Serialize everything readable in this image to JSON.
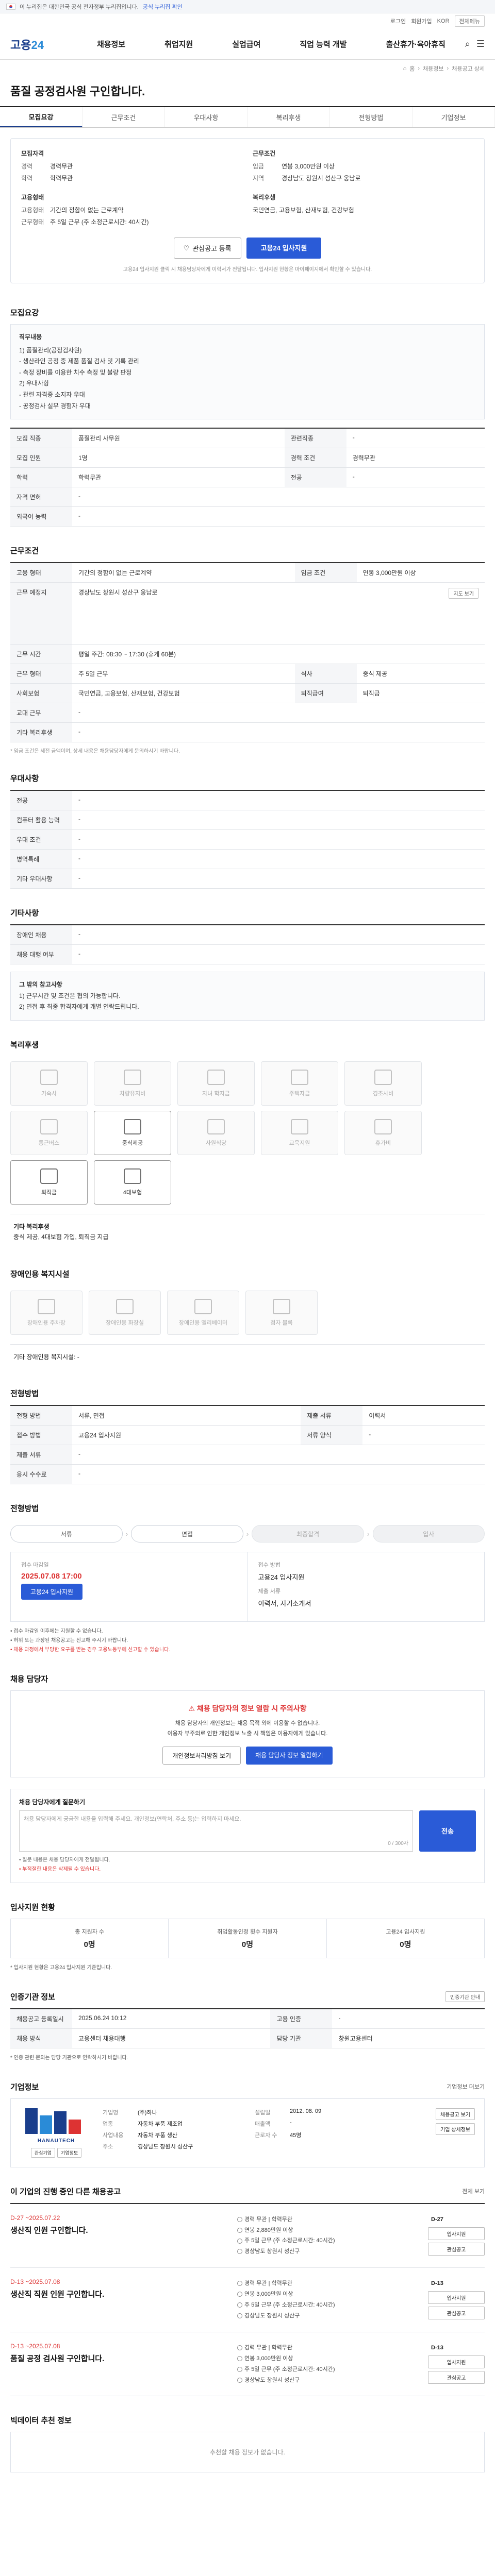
{
  "topbar": {
    "notice": "이 누리집은 대한민국 공식 전자정부 누리집입니다.",
    "link": "공식 누리집 확인"
  },
  "util": {
    "login": "로그인",
    "join": "회원가입",
    "lang": "KOR",
    "btn": "전체메뉴"
  },
  "header": {
    "logo_main": "고용",
    "logo_sub": "24",
    "gnb": [
      "채용정보",
      "취업지원",
      "실업급여",
      "직업 능력 개발",
      "출산휴가·육아휴직"
    ]
  },
  "breadcrumb": [
    "홈",
    "채용정보",
    "채용공고 상세"
  ],
  "title": "품질 공정검사원 구인합니다.",
  "tabs": [
    "모집요강",
    "근무조건",
    "우대사항",
    "복리후생",
    "전형방법",
    "기업정보"
  ],
  "summary": {
    "recruit_title": "모집자격",
    "recruit": [
      {
        "k": "경력",
        "v": "경력무관"
      },
      {
        "k": "학력",
        "v": "학력무관"
      }
    ],
    "work_title": "근무조건",
    "work": [
      {
        "k": "임금",
        "v": "연봉 3,000만원 이상"
      },
      {
        "k": "지역",
        "v": "경상남도 창원시 성산구 웅남로"
      }
    ],
    "type_title": "고용형태",
    "type": [
      {
        "k": "고용형태",
        "v": "기간의 정함이 없는 근로계약"
      },
      {
        "k": "근무형태",
        "v": "주 5일 근무 (주 소정근로시간: 40시간)"
      }
    ],
    "welfare_title": "복리후생",
    "welfare": [
      {
        "k": "",
        "v": "국민연금, 고용보험, 산재보험, 건강보험"
      }
    ],
    "interest_btn": "관심공고 등록",
    "apply_btn": "고용24 입사지원",
    "note": "고용24 입사지원 클릭 시 채용담당자에게 이력서가 전달됩니다. 입사지원 현황은 마이페이지에서 확인할 수 있습니다."
  },
  "recruit_section": {
    "title": "모집요강",
    "duties_label": "직무내용",
    "duties": [
      "1) 품질관리(공정검사원)",
      "- 생산라인 공정 중 제품 품질 검사 및 기록 관리",
      "- 측정 장비를 이용한 치수 측정 및 불량 판정",
      "2) 우대사항",
      "- 관련 자격증 소지자 우대",
      "- 공정검사 실무 경험자 우대"
    ],
    "table": [
      {
        "k": "모집 직종",
        "v": "품질관리 사무원",
        "k2": "관련직종",
        "v2": "-"
      },
      {
        "k": "모집 인원",
        "v": "1명",
        "k2": "경력 조건",
        "v2": "경력무관"
      },
      {
        "k": "학력",
        "v": "학력무관",
        "k2": "전공",
        "v2": "-"
      },
      {
        "k": "자격 면허",
        "v": "-",
        "k2": "",
        "v2": ""
      },
      {
        "k": "외국어 능력",
        "v": "-",
        "k2": "",
        "v2": ""
      }
    ]
  },
  "work_section": {
    "title": "근무조건",
    "table": [
      {
        "k": "고용 형태",
        "v": "기간의 정함이 없는 근로계약",
        "k2": "임금 조건",
        "v2": "연봉 3,000만원 이상"
      },
      {
        "k": "근무 예정지",
        "v": "경상남도 창원시 성산구 웅남로",
        "k2": "",
        "v2": ""
      },
      {
        "k": "근무 시간",
        "v": "평일 주간: 08:30 ~ 17:30 (휴게 60분)",
        "k2": "",
        "v2": ""
      },
      {
        "k": "근무 형태",
        "v": "주 5일 근무",
        "k2": "식사",
        "v2": "중식 제공"
      },
      {
        "k": "사회보험",
        "v": "국민연금, 고용보험, 산재보험, 건강보험",
        "k2": "퇴직급여",
        "v2": "퇴직금"
      },
      {
        "k": "교대 근무",
        "v": "-",
        "k2": "",
        "v2": ""
      },
      {
        "k": "기타 복리후생",
        "v": "-",
        "k2": "",
        "v2": ""
      }
    ],
    "map_btn": "지도 보기",
    "foot": "* 임금 조건은 세전 금액이며, 상세 내용은 채용담당자에게 문의하시기 바랍니다."
  },
  "pref_section": {
    "title": "우대사항",
    "table": [
      {
        "k": "전공",
        "v": "-"
      },
      {
        "k": "컴퓨터 활용 능력",
        "v": "-"
      },
      {
        "k": "우대 조건",
        "v": "-"
      },
      {
        "k": "병역특례",
        "v": "-"
      },
      {
        "k": "기타 우대사항",
        "v": "-"
      }
    ]
  },
  "etc_section": {
    "title": "기타사항",
    "table": [
      {
        "k": "장애인 채용",
        "v": "-"
      },
      {
        "k": "채용 대행 여부",
        "v": "-"
      }
    ],
    "notes_title": "그 밖의 참고사항",
    "notes": [
      "1) 근무시간 및 조건은 협의 가능합니다.",
      "2) 면접 후 최종 합격자에게 개별 연락드립니다."
    ]
  },
  "welfare_section": {
    "title": "복리후생",
    "items": [
      {
        "label": "기숙사",
        "on": false
      },
      {
        "label": "차량유지비",
        "on": false
      },
      {
        "label": "자녀 학자금",
        "on": false
      },
      {
        "label": "주택자금",
        "on": false
      },
      {
        "label": "경조사비",
        "on": false
      },
      {
        "label": "통근버스",
        "on": false
      },
      {
        "label": "중식제공",
        "on": true
      },
      {
        "label": "사원식당",
        "on": false
      },
      {
        "label": "교육지원",
        "on": false
      },
      {
        "label": "휴가비",
        "on": false
      },
      {
        "label": "퇴직금",
        "on": true
      },
      {
        "label": "4대보험",
        "on": true
      }
    ],
    "note_title": "기타 복리후생",
    "note": "중식 제공, 4대보험 가입, 퇴직금 지급"
  },
  "disability_section": {
    "title": "장애인용 복지시설",
    "items": [
      "장애인용 주차장",
      "장애인용 화장실",
      "장애인용 엘리베이터",
      "점자 블록"
    ],
    "note": "기타 장애인용 복지시설: -"
  },
  "process_section": {
    "title": "전형방법",
    "steps": [
      "서류",
      "면접",
      "최종합격"
    ],
    "table": [
      {
        "k": "전형 방법",
        "v": "서류, 면접",
        "k2": "제출 서류",
        "v2": "이력서"
      },
      {
        "k": "접수 방법",
        "v": "고용24 입사지원",
        "k2": "서류 양식",
        "v2": "-"
      },
      {
        "k": "제출 서류",
        "v": "-",
        "k2": "",
        "v2": ""
      },
      {
        "k": "응시 수수료",
        "v": "-",
        "k2": "",
        "v2": ""
      }
    ]
  },
  "apply_section": {
    "title": "전형방법",
    "steps": [
      "서류",
      "면접",
      "최종합격",
      "입사"
    ],
    "deadline_label": "접수 마감일",
    "deadline": "2025.07.08 17:00",
    "deadline_btn": "고용24 입사지원",
    "method_label": "접수 방법",
    "method": "고용24 입사지원",
    "doc_label": "제출 서류",
    "doc": "이력서, 자기소개서",
    "bullets": [
      "접수 마감일 이후에는 지원할 수 없습니다.",
      "허위 또는 과장된 채용공고는 신고해 주시기 바랍니다.",
      "채용 과정에서 부당한 요구를 받는 경우 고용노동부에 신고할 수 있습니다."
    ]
  },
  "contact_section": {
    "title": "채용 담당자",
    "warn": "채용 담당자의 정보 열람 시 주의사항",
    "lines": [
      "채용 담당자의 개인정보는 채용 목적 외에 이용할 수 없습니다.",
      "이용자 부주의로 인한 개인정보 노출 시 책임은 이용자에게 있습니다."
    ],
    "btn1": "개인정보처리방침 보기",
    "btn2": "채용 담당자 정보 열람하기"
  },
  "inquiry_section": {
    "title": "채용 담당자에게 질문하기",
    "placeholder": "채용 담당자에게 궁금한 내용을 입력해 주세요. 개인정보(연락처, 주소 등)는 입력하지 마세요.",
    "count": "0 / 300자",
    "send": "전송",
    "notes": [
      "질문 내용은 채용 담당자에게 전달됩니다.",
      "부적절한 내용은 삭제될 수 있습니다."
    ]
  },
  "status_section": {
    "title": "입사지원 현황",
    "cells": [
      {
        "h": "총 지원자 수",
        "n": "0명"
      },
      {
        "h": "취업활동인정 횟수 지원자",
        "n": "0명"
      },
      {
        "h": "고용24 입사지원",
        "n": "0명"
      }
    ],
    "foot": "* 입사지원 현황은 고용24 입사지원 기준입니다."
  },
  "guide_section": {
    "title": "인증기관 정보",
    "more": "인증기관 안내",
    "table": [
      {
        "k": "채용공고 등록일시",
        "v": "2025.06.24 10:12",
        "k2": "고용 인증",
        "v2": "-"
      },
      {
        "k": "채용 방식",
        "v": "고용센터 채용대행",
        "k2": "담당 기관",
        "v2": "창원고용센터"
      }
    ],
    "foot": "* 인증 관련 문의는 담당 기관으로 연락하시기 바랍니다."
  },
  "company_section": {
    "title": "기업정보",
    "more": "기업정보 더보기",
    "logo_text": "HANAUTECH",
    "btns": [
      "관심기업",
      "기업정보"
    ],
    "info": [
      {
        "k": "기업명",
        "v": "(주)하나",
        "k2": "설립일",
        "v2": "2012. 08. 09"
      },
      {
        "k": "업종",
        "v": "자동차 부품 제조업",
        "k2": "매출액",
        "v2": "-"
      },
      {
        "k": "사업내용",
        "v": "자동차 부품 생산",
        "k2": "근로자 수",
        "v2": "45명"
      },
      {
        "k": "주소",
        "v": "경상남도 창원시 성산구",
        "k2": "",
        "v2": ""
      }
    ],
    "side": [
      "채용공고 보기",
      "기업 상세정보"
    ]
  },
  "jobs_section": {
    "title": "이 기업의 진행 중인 다른 채용공고",
    "more": "전체 보기",
    "items": [
      {
        "date": "D-27  ~2025.07.22",
        "title": "생산직 인원 구인합니다.",
        "lines": [
          "경력 무관  |  학력무관",
          "연봉 2,880만원 이상",
          "주 5일 근무 (주 소정근로시간: 40시간)",
          "경상남도 창원시 성산구"
        ],
        "dday": "D-27",
        "btns": [
          "입사지원",
          "관심공고"
        ]
      },
      {
        "date": "D-13  ~2025.07.08",
        "title": "생산직 직원 인원 구인합니다.",
        "lines": [
          "경력 무관  |  학력무관",
          "연봉 3,000만원 이상",
          "주 5일 근무 (주 소정근로시간: 40시간)",
          "경상남도 창원시 성산구"
        ],
        "dday": "D-13",
        "btns": [
          "입사지원",
          "관심공고"
        ]
      },
      {
        "date": "D-13  ~2025.07.08",
        "title": "품질 공정 검사원 구인합니다.",
        "lines": [
          "경력 무관  |  학력무관",
          "연봉 3,000만원 이상",
          "주 5일 근무 (주 소정근로시간: 40시간)",
          "경상남도 창원시 성산구"
        ],
        "dday": "D-13",
        "btns": [
          "입사지원",
          "관심공고"
        ]
      }
    ]
  },
  "recommend_section": {
    "title": "빅데이터 추천 정보",
    "empty": "추천할 채용 정보가 없습니다."
  }
}
